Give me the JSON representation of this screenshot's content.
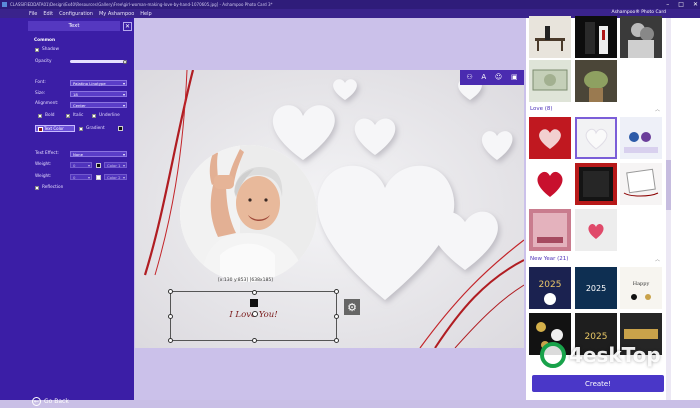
{
  "window": {
    "title": "CLASSIFIEDDATA01\\Design\\Ex40\\Resources\\Gallery\\Free\\girl-woman-making-love-by-hand-1070605.jpg] - Ashampoo Photo Card 3*",
    "brand": "Ashampoo® Photo Card"
  },
  "window_controls": {
    "minimize": "–",
    "maximize": "□",
    "close": "✕"
  },
  "menu": [
    "File",
    "Edit",
    "Configuration",
    "My Ashampoo",
    "Help"
  ],
  "panel": {
    "header": "Text",
    "close_icon": "✕",
    "common": "Common",
    "shadow": "Shadow",
    "opacity": "Opacity",
    "font_label": "Font:",
    "font_value": "Palatino Linotype",
    "size_label": "Size:",
    "size_value": "18",
    "alignment_label": "Alignment:",
    "alignment_value": "Center",
    "bold": "Bold",
    "italic": "Italic",
    "underline": "Underline",
    "text_color": "Text Color",
    "gradient": "Gradient",
    "effect_label": "Text Effect:",
    "effect_value": "None",
    "weight_label": "Weight:",
    "weight1": "0",
    "color1": "Color 1",
    "weight2_label": "Weight:",
    "weight2": "0",
    "color2": "Color 2",
    "reflection": "Reflection"
  },
  "go_back": "Go Back",
  "canvas": {
    "size_label": "[x:130 y:853] [638x185]",
    "text": "I Love You!"
  },
  "gallery": {
    "love_header": "Love (8)",
    "newyear_header": "New Year (21)"
  },
  "create": "Create!",
  "watermark": "4eskTop",
  "colors": {
    "sidebar": "#3b1ea6",
    "accent": "#4a37c8",
    "text_color": "#8b1818",
    "selection": "#7b5ed8"
  }
}
